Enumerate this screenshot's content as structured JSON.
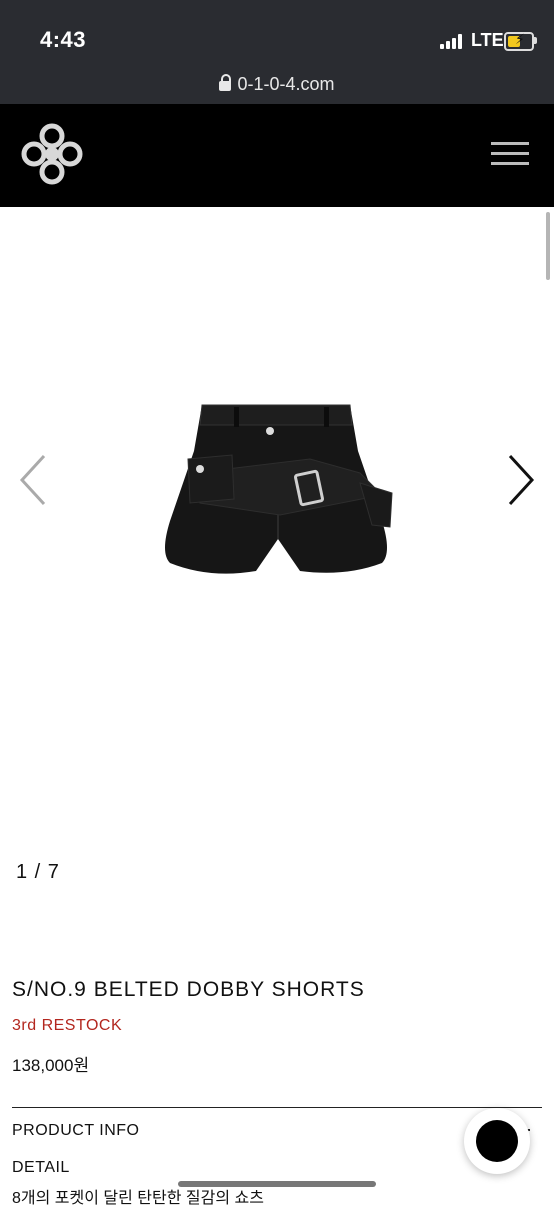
{
  "status_bar": {
    "time": "4:43",
    "network": "LTE",
    "url": "0-1-0-4.com"
  },
  "header": {
    "logo_icon": "brand-logo-icon",
    "menu_icon": "hamburger-menu-icon"
  },
  "gallery": {
    "counter": "1 / 7",
    "prev_icon": "chevron-left-icon",
    "next_icon": "chevron-right-icon"
  },
  "product": {
    "name": "S/NO.9 BELTED DOBBY SHORTS",
    "badge": "3rd RESTOCK",
    "price": "138,000원",
    "info_heading": "PRODUCT INFO",
    "detail_heading": "DETAIL",
    "description": "8개의 포켓이 달린 탄탄한 질감의 쇼츠"
  },
  "colors": {
    "status_bar_bg": "#2a2c31",
    "header_bg": "#000000",
    "restock_red": "#b3261e"
  }
}
